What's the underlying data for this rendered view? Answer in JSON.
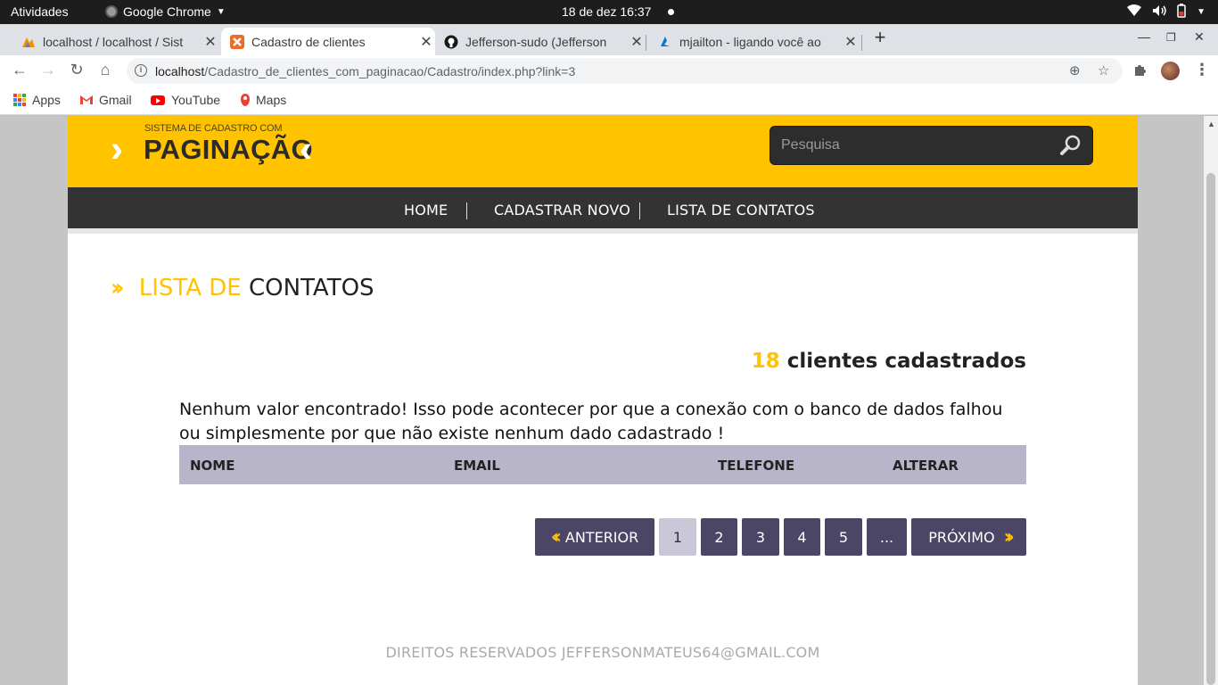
{
  "os": {
    "activities": "Atividades",
    "app_name": "Google Chrome",
    "clock": "18 de dez  16:37"
  },
  "browser": {
    "tabs": [
      {
        "title": "localhost / localhost / Sist",
        "favicon_color": "#f29100"
      },
      {
        "title": "Cadastro de clientes",
        "favicon_color": "#ee6a28",
        "active": true
      },
      {
        "title": "Jefferson-sudo (Jefferson",
        "favicon_color": "#181717"
      },
      {
        "title": "mjailton - ligando você ao",
        "favicon_color": "#0078d4"
      }
    ],
    "url_host": "localhost",
    "url_path": "/Cadastro_de_clientes_com_paginacao/Cadastro/index.php?link=3",
    "bookmarks": [
      {
        "label": "Apps"
      },
      {
        "label": "Gmail"
      },
      {
        "label": "YouTube"
      },
      {
        "label": "Maps"
      }
    ]
  },
  "site": {
    "logo_small": "SISTEMA DE CADASTRO COM",
    "logo_big": "PAGINAÇÃO",
    "search_placeholder": "Pesquisa",
    "nav": [
      "HOME",
      "CADASTRAR NOVO",
      "LISTA DE CONTATOS"
    ],
    "section_title_part1": "LISTA DE",
    "section_title_part2": "CONTATOS",
    "count_number": "18",
    "count_text": "clientes cadastrados",
    "message": "Nenhum valor encontrado! Isso pode acontecer por que a conexão com o banco de dados falhou ou simplesmente por que não existe nenhum dado cadastrado !",
    "table_headers": [
      "NOME",
      "EMAIL",
      "TELEFONE",
      "ALTERAR"
    ],
    "pagination": {
      "prev": "ANTERIOR",
      "pages": [
        "1",
        "2",
        "3",
        "4",
        "5",
        "..."
      ],
      "current": "1",
      "next": "PRÓXIMO"
    },
    "footer": "DIREITOS RESERVADOS JEFFERSONMATEUS64@GMAIL.COM"
  },
  "colors": {
    "brand_yellow": "#ffc300",
    "nav_dark": "#333333",
    "pager_purple": "#4b4566",
    "table_head": "#b8b5cb"
  }
}
